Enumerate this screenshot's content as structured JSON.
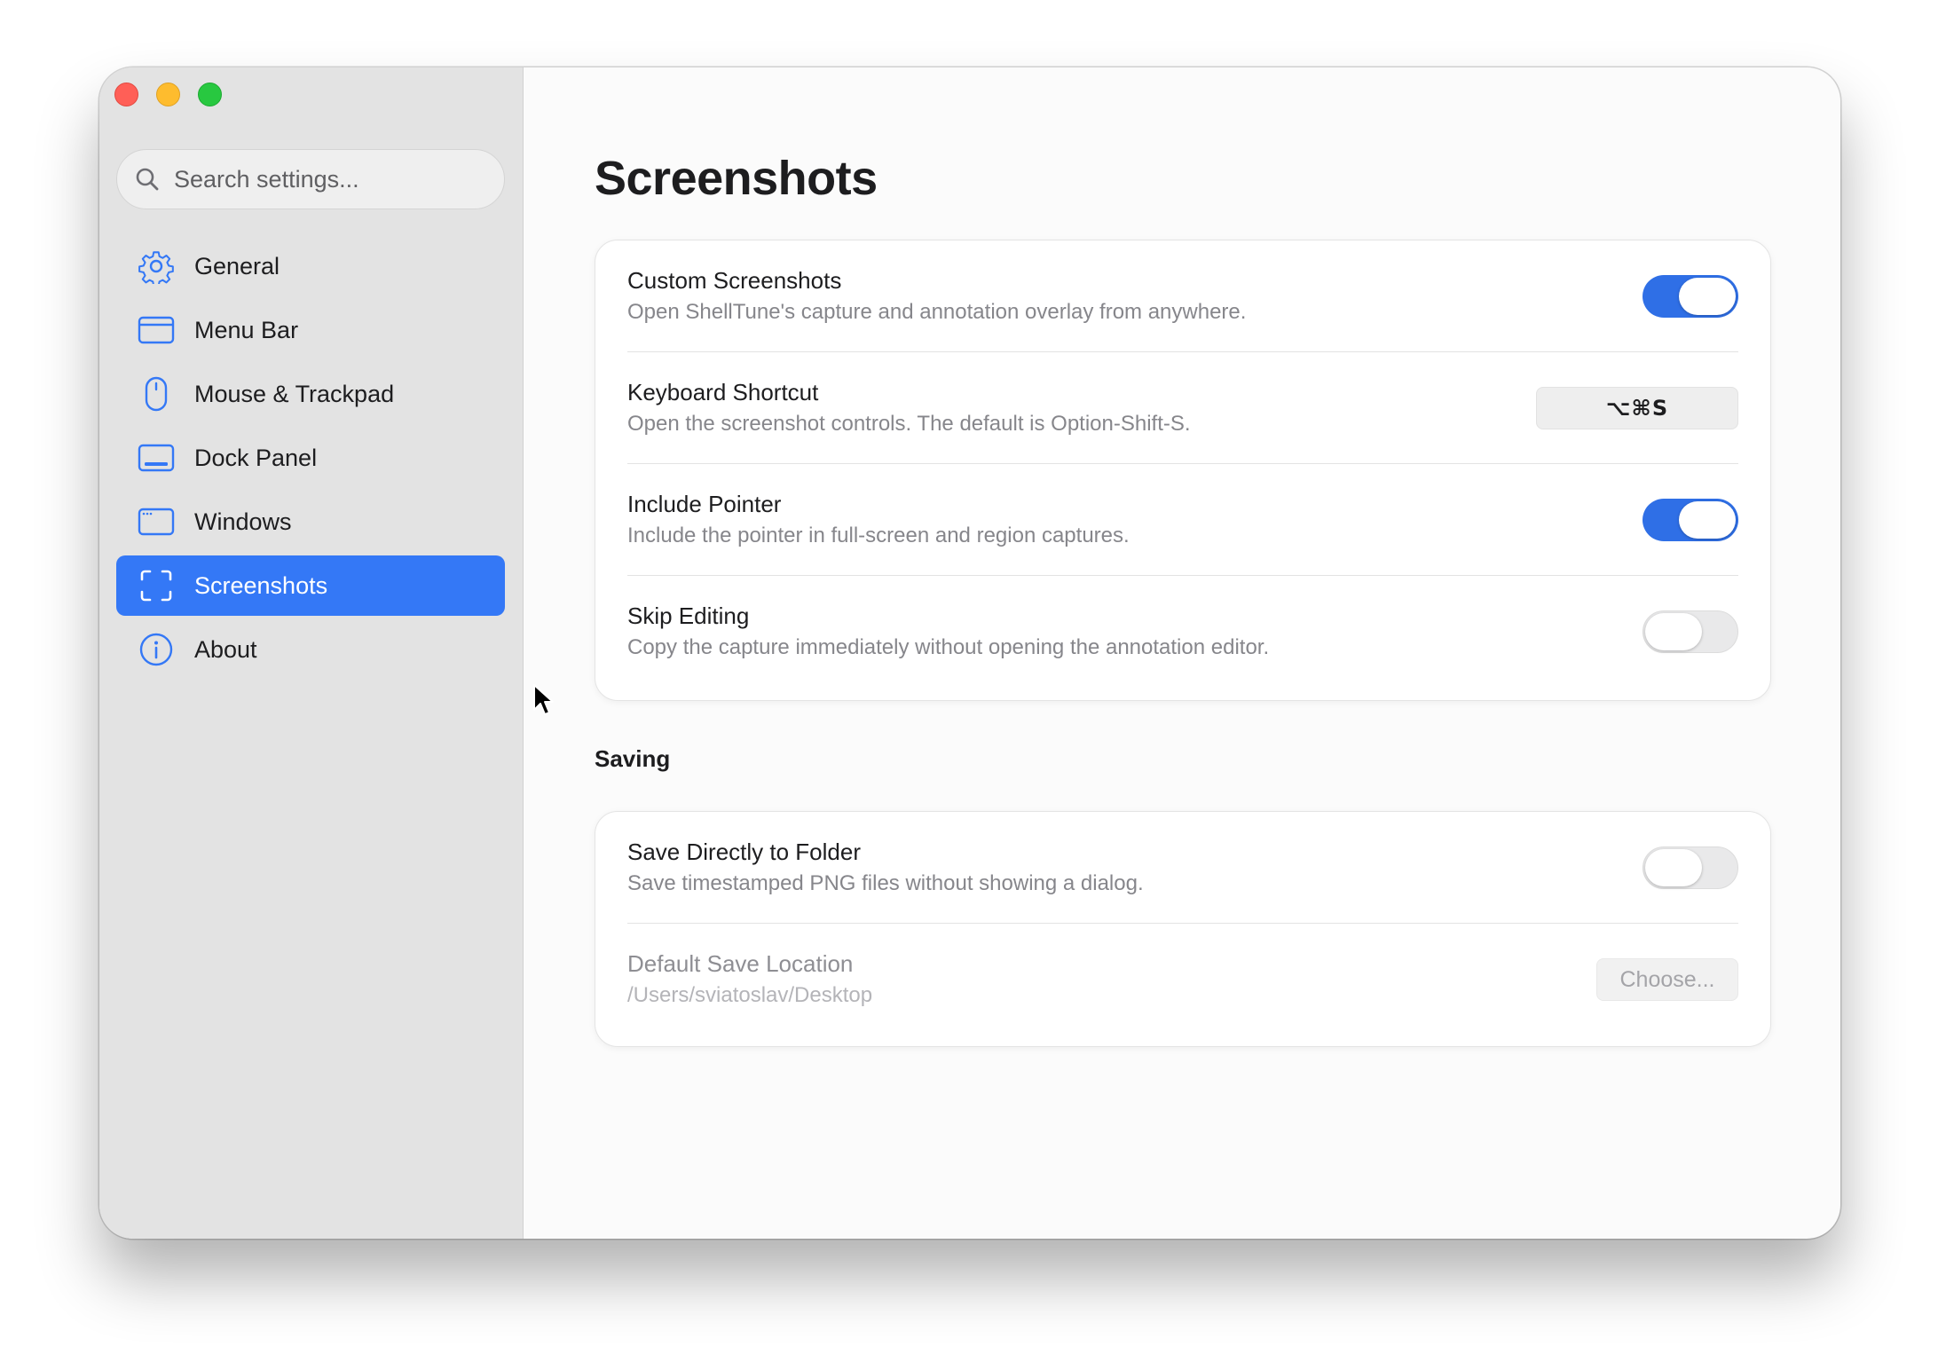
{
  "window": {
    "traffic_lights": [
      "close",
      "minimize",
      "zoom"
    ]
  },
  "sidebar": {
    "search_placeholder": "Search settings...",
    "items": [
      {
        "label": "General",
        "icon": "gear-icon",
        "active": false
      },
      {
        "label": "Menu Bar",
        "icon": "menu-bar-icon",
        "active": false
      },
      {
        "label": "Mouse & Trackpad",
        "icon": "mouse-icon",
        "active": false
      },
      {
        "label": "Dock Panel",
        "icon": "dock-icon",
        "active": false
      },
      {
        "label": "Windows",
        "icon": "window-icon",
        "active": false
      },
      {
        "label": "Screenshots",
        "icon": "screenshot-icon",
        "active": true
      },
      {
        "label": "About",
        "icon": "info-icon",
        "active": false
      }
    ]
  },
  "main": {
    "title": "Screenshots",
    "screenshots_group": [
      {
        "title": "Custom Screenshots",
        "desc": "Open ShellTune's capture and annotation overlay from anywhere.",
        "control": "toggle",
        "on": true
      },
      {
        "title": "Keyboard Shortcut",
        "desc": "Open the screenshot controls. The default is Option-Shift-S.",
        "control": "shortcut",
        "value": "⌥⌘S"
      },
      {
        "title": "Include Pointer",
        "desc": "Include the pointer in full-screen and region captures.",
        "control": "toggle",
        "on": true
      },
      {
        "title": "Skip Editing",
        "desc": "Copy the capture immediately without opening the annotation editor.",
        "control": "toggle",
        "on": false
      }
    ],
    "saving_section_title": "Saving",
    "saving_group": [
      {
        "title": "Save Directly to Folder",
        "desc": "Save timestamped PNG files without showing a dialog.",
        "control": "toggle",
        "on": false
      },
      {
        "title": "Default Save Location",
        "desc": "/Users/sviatoslav/Desktop",
        "control": "button",
        "button_label": "Choose...",
        "disabled": true
      }
    ]
  },
  "colors": {
    "accent": "#3478f6",
    "toggle_on": "#2f6fe6",
    "sidebar_bg": "#e3e3e3",
    "content_bg": "#fbfbfb"
  }
}
